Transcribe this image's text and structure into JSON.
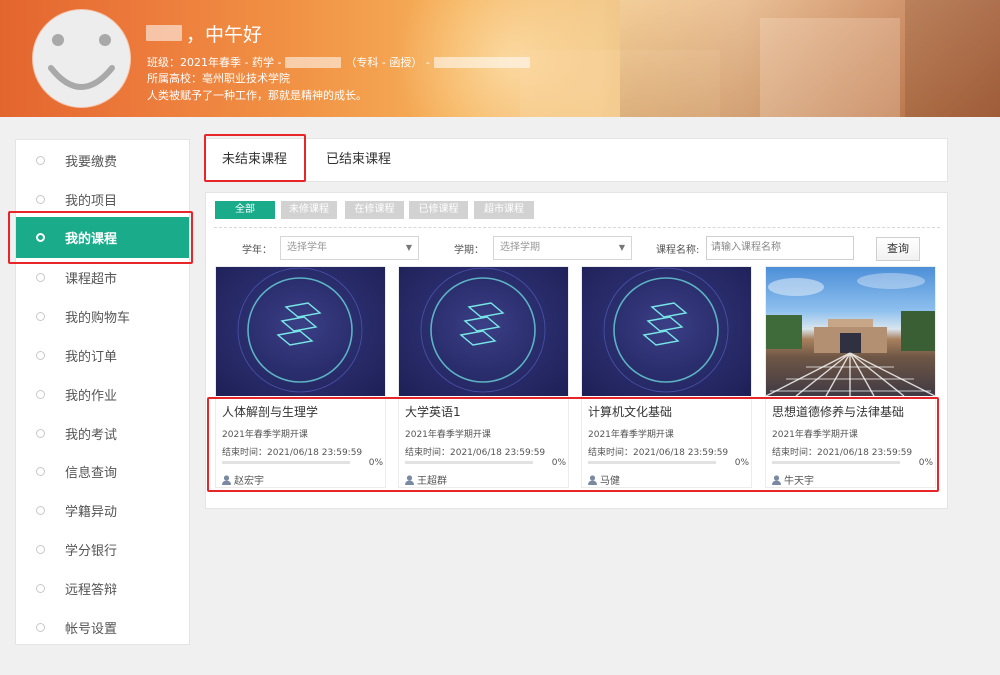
{
  "header": {
    "greeting": "，中午好",
    "class_label": "班级：",
    "class_value": "2021年春季 - 药学 - ",
    "class_major_type": "（专科 - 函授） - ",
    "school_label": "所属高校：",
    "school_value": "亳州职业技术学院",
    "motto": "人类被赋予了一种工作，那就是精神的成长。"
  },
  "sidebar": {
    "items": [
      {
        "label": "我要缴费"
      },
      {
        "label": "我的项目"
      },
      {
        "label": "我的课程",
        "active": true
      },
      {
        "label": "课程超市"
      },
      {
        "label": "我的购物车"
      },
      {
        "label": "我的订单"
      },
      {
        "label": "我的作业"
      },
      {
        "label": "我的考试"
      },
      {
        "label": "信息查询"
      },
      {
        "label": "学籍异动"
      },
      {
        "label": "学分银行"
      },
      {
        "label": "远程答辩"
      },
      {
        "label": "帐号设置"
      }
    ]
  },
  "tabs": [
    {
      "label": "未结束课程",
      "active": true
    },
    {
      "label": "已结束课程"
    }
  ],
  "filters": {
    "chips": [
      {
        "label": "全部",
        "active": true
      },
      {
        "label": "未修课程"
      },
      {
        "label": "在修课程"
      },
      {
        "label": "已修课程"
      },
      {
        "label": "超市课程"
      }
    ],
    "year_label": "学年：",
    "year_placeholder": "选择学年",
    "term_label": "学期：",
    "term_placeholder": "选择学期",
    "course_name_label": "课程名称:",
    "course_name_placeholder": "请输入课程名称",
    "query_button": "查询"
  },
  "courses": [
    {
      "title": "人体解剖与生理学",
      "term": "2021年春季学期开课",
      "end_time": "结束时间：2021/06/18 23:59:59",
      "progress_text": "0%",
      "progress": 0,
      "teacher": "赵宏宇",
      "thumb": "dark"
    },
    {
      "title": "大学英语1",
      "term": "2021年春季学期开课",
      "end_time": "结束时间：2021/06/18 23:59:59",
      "progress_text": "0%",
      "progress": 0,
      "teacher": "王超群",
      "thumb": "dark"
    },
    {
      "title": "计算机文化基础",
      "term": "2021年春季学期开课",
      "end_time": "结束时间：2021/06/18 23:59:59",
      "progress_text": "0%",
      "progress": 0,
      "teacher": "马健",
      "thumb": "dark"
    },
    {
      "title": "思想道德修养与法律基础",
      "term": "2021年春季学期开课",
      "end_time": "结束时间：2021/06/18 23:59:59",
      "progress_text": "0%",
      "progress": 0,
      "teacher": "牛天宇",
      "thumb": "campus"
    }
  ],
  "colors": {
    "accent": "#1aab8a",
    "highlight_box": "#e8262a"
  },
  "icons": {
    "avatar": "smiley-avatar-icon",
    "radio": "radio-dot-icon",
    "teacher": "user-icon",
    "dropdown": "caret-down-icon",
    "course_logo": "layers-logo-icon"
  }
}
